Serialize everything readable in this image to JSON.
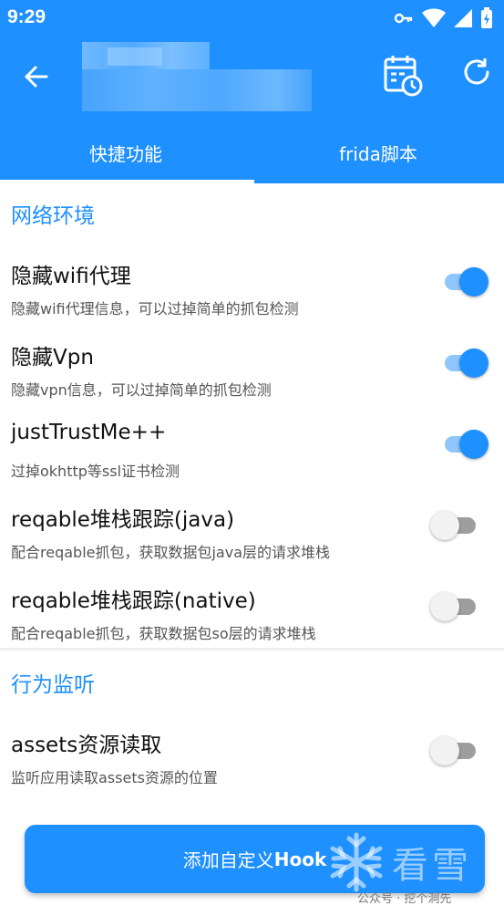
{
  "status_bar": {
    "time": "9:29"
  },
  "tabs": [
    {
      "label": "快捷功能",
      "active": true
    },
    {
      "label": "frida脚本",
      "active": false
    }
  ],
  "sections": [
    {
      "title": "网络环境",
      "items": [
        {
          "title": "隐藏wifi代理",
          "desc": "隐藏wifi代理信息，可以过掉简单的抓包检测",
          "enabled": true
        },
        {
          "title": "隐藏Vpn",
          "desc": "隐藏vpn信息，可以过掉简单的抓包检测",
          "enabled": true
        },
        {
          "title": "justTrustMe++",
          "desc": "过掉okhttp等ssl证书检测",
          "enabled": true
        },
        {
          "title": "reqable堆栈跟踪(java)",
          "desc": "配合reqable抓包，获取数据包java层的请求堆栈",
          "enabled": false
        },
        {
          "title": "reqable堆栈跟踪(native)",
          "desc": "配合reqable抓包，获取数据包so层的请求堆栈",
          "enabled": false
        }
      ]
    },
    {
      "title": "行为监听",
      "items": [
        {
          "title": "assets资源读取",
          "desc": "监听应用读取assets资源的位置",
          "enabled": false
        }
      ]
    }
  ],
  "add_button": {
    "label_prefix": "添加自定义",
    "label_bold": "Hook"
  },
  "watermark": {
    "text": "看雪",
    "sub": "公众号 · 挖个洞先"
  },
  "colors": {
    "primary": "#1e90ff",
    "switch_on_track": "#8fc6fb",
    "switch_off_thumb": "#f2f2f2"
  }
}
